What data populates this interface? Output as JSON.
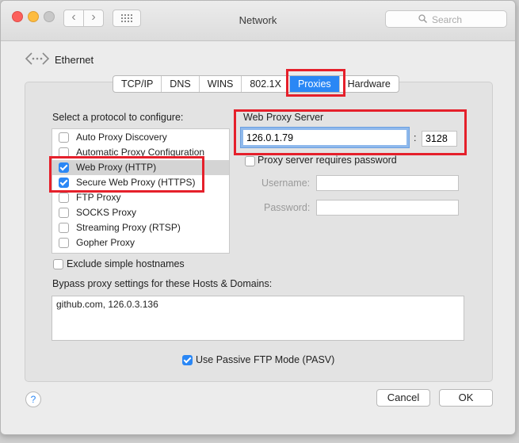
{
  "window": {
    "title": "Network"
  },
  "toolbar": {
    "back_label": "‹",
    "forward_label": "›",
    "search_placeholder": "Search"
  },
  "interface": {
    "name": "Ethernet"
  },
  "tabs": [
    {
      "label": "TCP/IP"
    },
    {
      "label": "DNS"
    },
    {
      "label": "WINS"
    },
    {
      "label": "802.1X"
    },
    {
      "label": "Proxies",
      "active": true
    },
    {
      "label": "Hardware"
    }
  ],
  "protocols": {
    "heading": "Select a protocol to configure:",
    "items": [
      {
        "label": "Auto Proxy Discovery",
        "checked": false
      },
      {
        "label": "Automatic Proxy Configuration",
        "checked": false
      },
      {
        "label": "Web Proxy (HTTP)",
        "checked": true
      },
      {
        "label": "Secure Web Proxy (HTTPS)",
        "checked": true
      },
      {
        "label": "FTP Proxy",
        "checked": false
      },
      {
        "label": "SOCKS Proxy",
        "checked": false
      },
      {
        "label": "Streaming Proxy (RTSP)",
        "checked": false
      },
      {
        "label": "Gopher Proxy",
        "checked": false
      }
    ],
    "selected_index": 2
  },
  "web_proxy": {
    "heading": "Web Proxy Server",
    "host": "126.0.1.79",
    "separator": ":",
    "port": "3128",
    "requires_password_label": "Proxy server requires password",
    "username_label": "Username:",
    "username": "",
    "password_label": "Password:",
    "password": ""
  },
  "exclude_simple_hostnames_label": "Exclude simple hostnames",
  "bypass": {
    "label": "Bypass proxy settings for these Hosts & Domains:",
    "value": "github.com, 126.0.3.136"
  },
  "passive_ftp_label": "Use Passive FTP Mode (PASV)",
  "buttons": {
    "help": "?",
    "cancel": "Cancel",
    "ok": "OK"
  },
  "colors": {
    "accent": "#2a87f5",
    "highlight_box": "#e5202b"
  }
}
